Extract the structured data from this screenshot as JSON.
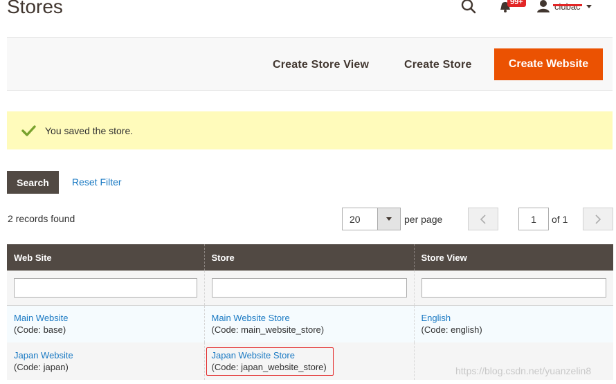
{
  "header": {
    "title": "Stores",
    "notification_count": "99+",
    "user_name": "ciubac"
  },
  "actions": {
    "create_store_view": "Create Store View",
    "create_store": "Create Store",
    "create_website": "Create Website"
  },
  "message": {
    "text": "You saved the store."
  },
  "filters": {
    "search_label": "Search",
    "reset_label": "Reset Filter"
  },
  "pager": {
    "records": "2 records found",
    "per_page_value": "20",
    "per_page_label": "per page",
    "current_page": "1",
    "of_label": "of 1"
  },
  "grid": {
    "columns": [
      "Web Site",
      "Store",
      "Store View"
    ],
    "rows": [
      {
        "website": "Main Website",
        "website_code": "(Code: base)",
        "store": "Main Website Store",
        "store_code": "(Code: main_website_store)",
        "view": "English",
        "view_code": "(Code: english)"
      },
      {
        "website": "Japan Website",
        "website_code": "(Code: japan)",
        "store": "Japan Website Store",
        "store_code": "(Code: japan_website_store)",
        "view": "",
        "view_code": ""
      }
    ]
  },
  "watermark": "https://blog.csdn.net/yuanzelin8",
  "colors": {
    "primary": "#eb5202",
    "header_bg": "#514943",
    "link": "#1979c3",
    "success_bg": "#fffbbb",
    "success_icon": "#79a22e",
    "highlight": "#e22626"
  },
  "icons": [
    "search-icon",
    "bell-icon",
    "user-icon",
    "check-icon",
    "chevron-left-icon",
    "chevron-right-icon"
  ]
}
